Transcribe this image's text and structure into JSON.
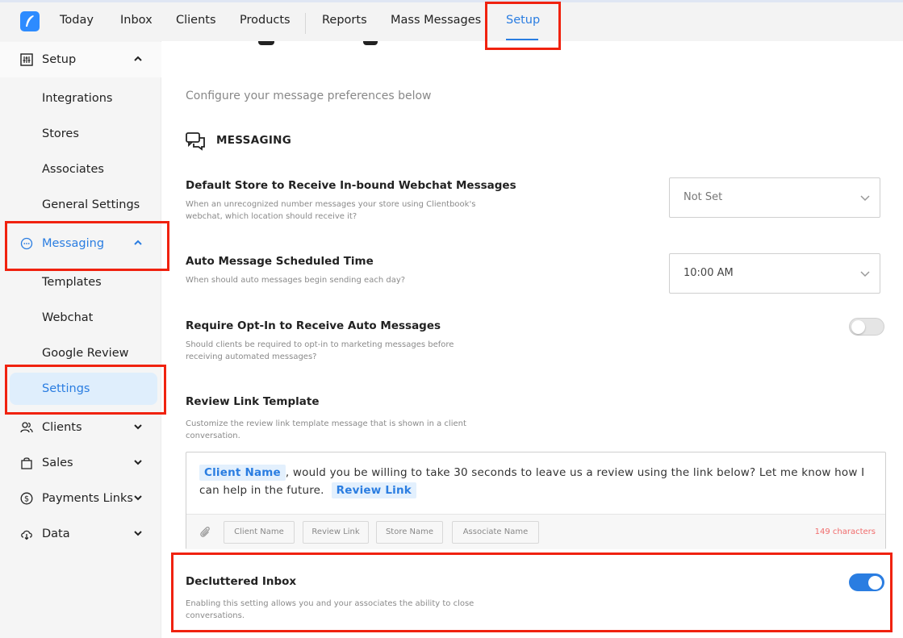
{
  "nav": {
    "items": [
      "Today",
      "Inbox",
      "Clients",
      "Products",
      "Reports",
      "Mass Messages",
      "Setup"
    ],
    "active": "Setup"
  },
  "sidebar": {
    "setup_label": "Setup",
    "setup_sub": [
      "Integrations",
      "Stores",
      "Associates",
      "General Settings"
    ],
    "messaging_label": "Messaging",
    "messaging_sub": [
      "Templates",
      "Webchat",
      "Google Review",
      "Settings"
    ],
    "other": [
      "Clients",
      "Sales",
      "Payments Links",
      "Data"
    ]
  },
  "main": {
    "subtitle": "Configure your message preferences below",
    "section_title": "MESSAGING",
    "settings": {
      "default_store": {
        "title": "Default Store to Receive In-bound Webchat Messages",
        "desc": "When an unrecognized number messages your store using Clientbook's webchat, which location should receive it?",
        "value": "Not Set"
      },
      "auto_time": {
        "title": "Auto Message Scheduled Time",
        "desc": "When should auto messages begin sending each day?",
        "value": "10:00 AM"
      },
      "opt_in": {
        "title": "Require Opt-In to Receive Auto Messages",
        "desc": "Should clients be required to opt-in to marketing messages before receiving automated messages?",
        "enabled": false
      },
      "review_link": {
        "title": "Review Link Template",
        "desc": "Customize the review link template message that is shown in a client conversation.",
        "chip_client": "Client Name",
        "text_middle": ", would you be willing to take 30 seconds to leave us a review using the link below? Let me know how I can help in the future.",
        "chip_review": "Review Link",
        "tags": [
          "Client Name",
          "Review Link",
          "Store Name",
          "Associate Name"
        ],
        "char_count": "149 characters"
      },
      "decluttered": {
        "title": "Decluttered Inbox",
        "desc": "Enabling this setting allows you and your associates the ability to close conversations.",
        "enabled": true
      }
    }
  },
  "colors": {
    "accent": "#2a7de1",
    "highlight": "#f0220f",
    "char_count": "#f06c6c"
  }
}
